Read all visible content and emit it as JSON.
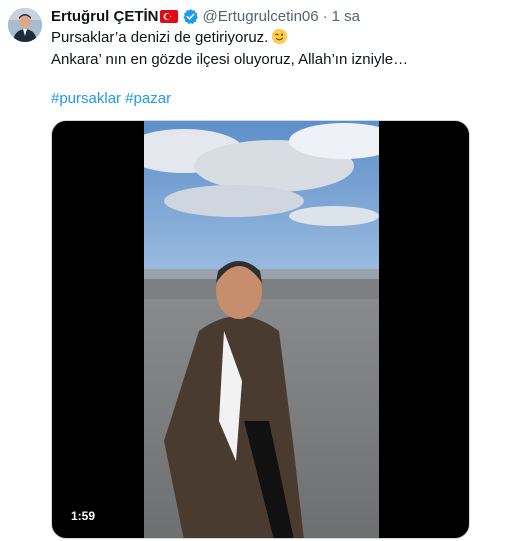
{
  "author": {
    "name": "Ertuğrul ÇETİN",
    "handle": "@Ertugrulcetin06",
    "separator": "·",
    "time": "1 sa"
  },
  "icons": {
    "flag": "turkey-flag-icon",
    "verified": "verified-badge-icon",
    "emoji": "winking-face-emoji"
  },
  "tweet": {
    "line1": "Pursaklar’a denizi de getiriyoruz.",
    "line2": "Ankara’ nın en gözde ilçesi oluyoruz, Allah’ın izniyle…",
    "hashtags": [
      "#pursaklar",
      "#pazar"
    ]
  },
  "video": {
    "duration": "1:59"
  },
  "colors": {
    "link": "#1d9bf0",
    "secondary_text": "#536471",
    "verified": "#1d9bf0",
    "flag_red": "#e30a17"
  }
}
